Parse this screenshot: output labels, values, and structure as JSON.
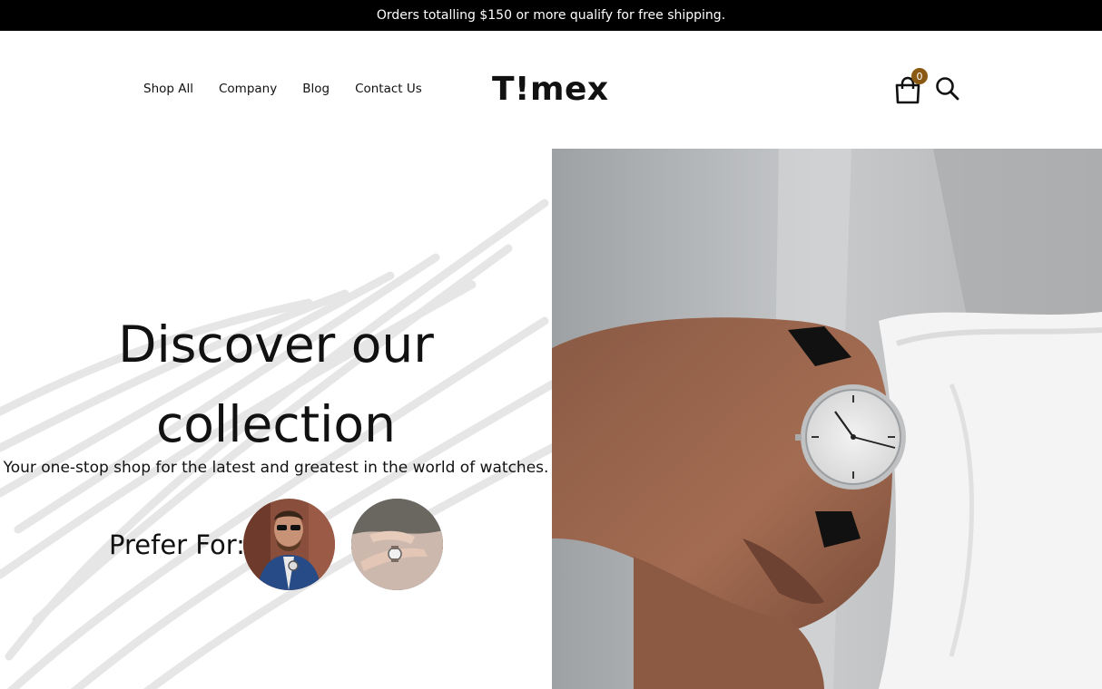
{
  "promo": {
    "text": "Orders totalling $150 or more qualify for free shipping."
  },
  "nav": {
    "items": [
      {
        "label": "Shop All"
      },
      {
        "label": "Company"
      },
      {
        "label": "Blog"
      },
      {
        "label": "Contact Us"
      }
    ]
  },
  "brand": {
    "logo": "T!mex"
  },
  "cart": {
    "count": "0",
    "icon": "shopping-bag-icon",
    "badge_color": "#8a5a14"
  },
  "search": {
    "icon": "search-icon"
  },
  "hero": {
    "headline_line1": "Discover our",
    "headline_line2": "collection",
    "subheadline": "Your one-stop shop for the latest and greatest in the world of watches.",
    "prefer_label": "Prefer For:"
  },
  "colors": {
    "promo_bg": "#000000",
    "text": "#111111",
    "accent": "#8a5a14"
  }
}
